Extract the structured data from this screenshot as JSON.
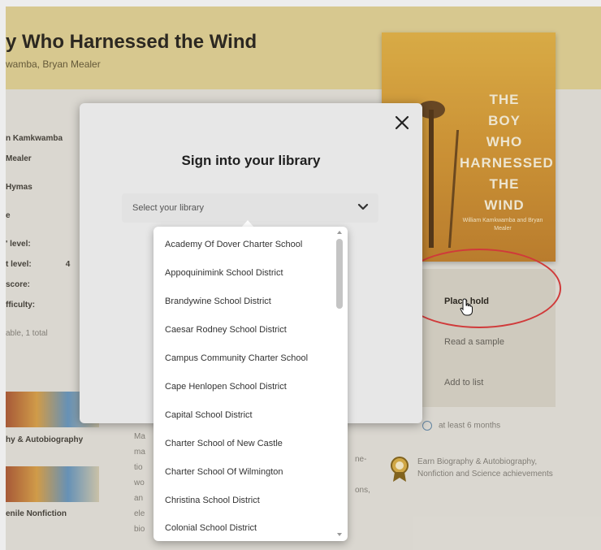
{
  "book": {
    "title": "y Who Harnessed the Wind",
    "authors": "wamba, Bryan Mealer",
    "cover": {
      "tagline_1": "",
      "title_lines": [
        "THE",
        "BOY",
        "WHO",
        "HARNESSED",
        "THE",
        "WIND"
      ],
      "authors": "William Kamkwamba and Bryan Mealer"
    }
  },
  "meta": {
    "rows": [
      "n Kamkwamba",
      "Mealer",
      "Hymas",
      "e",
      "' level:",
      "t level:",
      "score:",
      "fficulty:",
      "able, 1 total"
    ],
    "row4_value": "4"
  },
  "actions": {
    "place_hold": "Place hold",
    "read_sample": "Read a sample",
    "add_to_list": "Add to list",
    "wait_time": "at least 6 months",
    "achievement": "Earn Biography & Autobiography, Nonfiction and Science achievements"
  },
  "categories": [
    "hy & Autobiography",
    "enile Nonfiction"
  ],
  "description_fragments": [
    "Ma",
    "ma",
    "tio",
    "wo",
    "an",
    "ele",
    "bio"
  ],
  "description_right": [
    "ne-",
    "ons,"
  ],
  "modal": {
    "title": "Sign into your library",
    "select_placeholder": "Select your library",
    "libraries": [
      "Academy Of Dover Charter School",
      "Appoquinimink School District",
      "Brandywine School District",
      "Caesar Rodney School District",
      "Campus Community Charter School",
      "Cape Henlopen School District",
      "Capital School District",
      "Charter School of New Castle",
      "Charter School Of Wilmington",
      "Christina School District",
      "Colonial School District"
    ],
    "scroll_position": 0.0
  },
  "colors": {
    "header_band": "#e8d79a",
    "annotation_ring": "#d03a3a",
    "modal_bg": "#e7e7e7"
  },
  "icons": [
    "close-icon",
    "chevron-down-icon",
    "clock-icon",
    "award-badge-icon",
    "hand-cursor-icon"
  ]
}
